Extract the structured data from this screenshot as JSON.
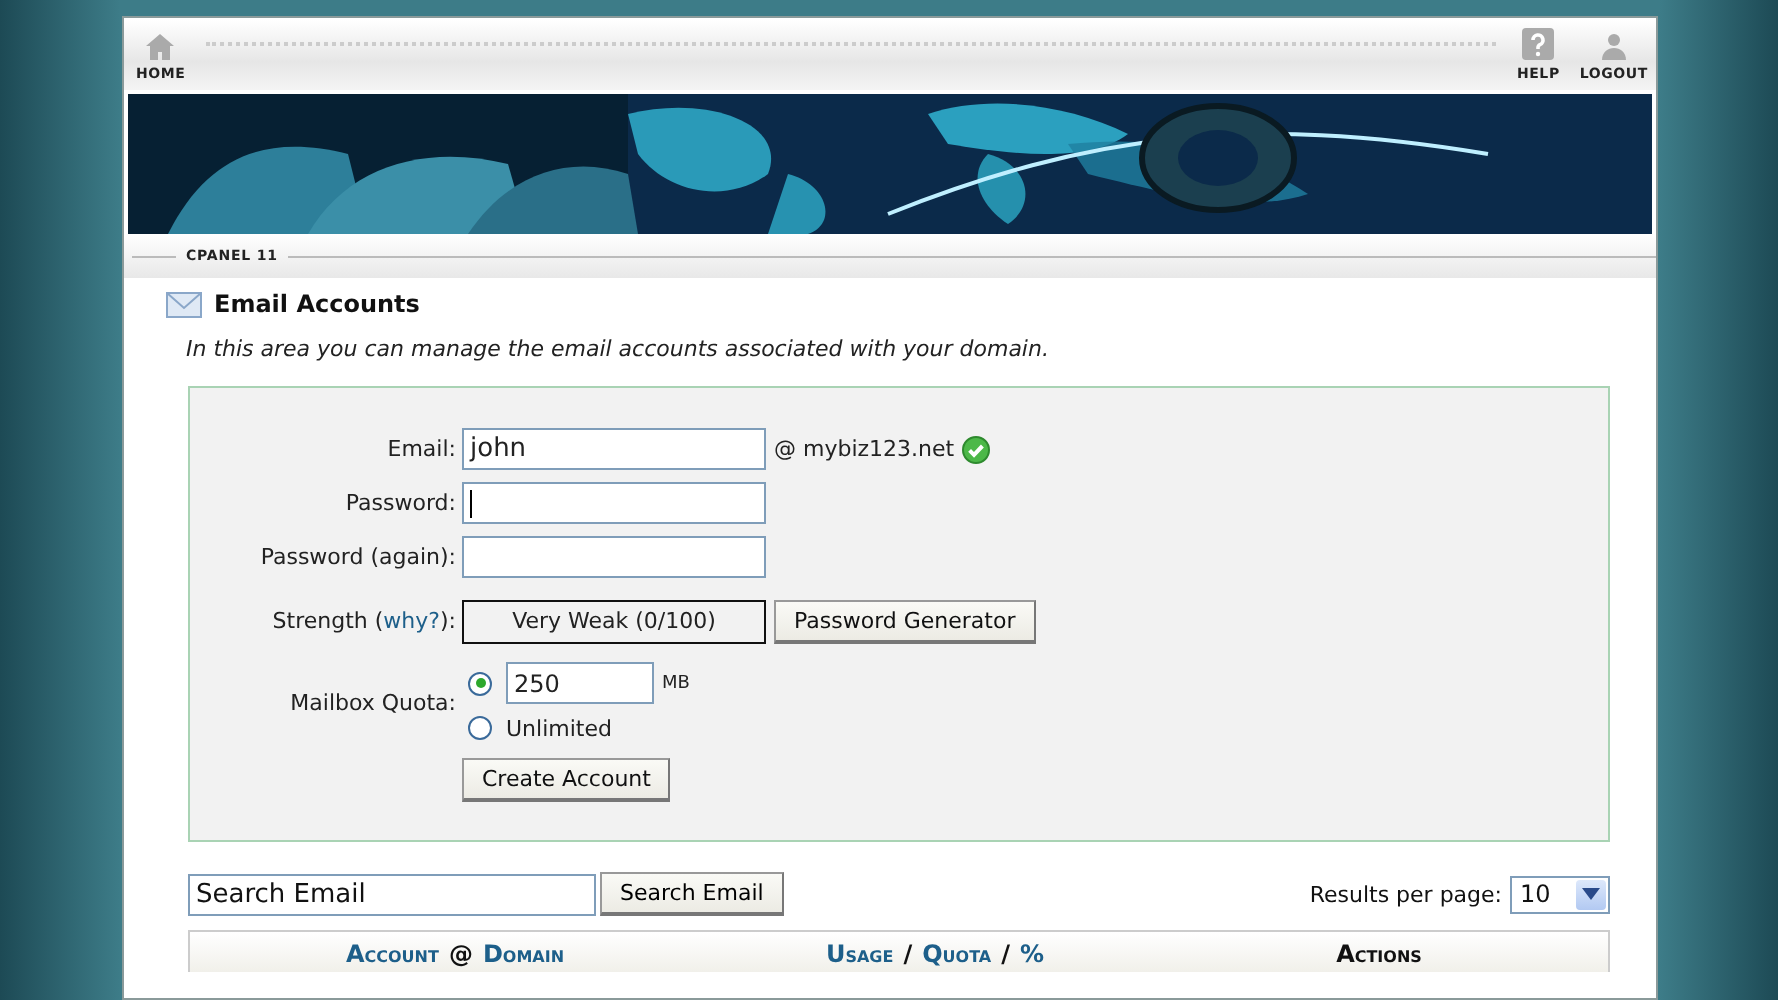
{
  "nav": {
    "home": "HOME",
    "help": "HELP",
    "logout": "LOGOUT"
  },
  "breadcrumb": "CPANEL 11",
  "section": {
    "title": "Email Accounts",
    "description": "In this area you can manage the email accounts associated with your domain."
  },
  "form": {
    "email_label": "Email:",
    "email_value": "john",
    "domain": "@ mybiz123.net",
    "email_valid": true,
    "password_label": "Password:",
    "password_again_label": "Password (again):",
    "strength_before": "Strength (",
    "strength_link": "why?",
    "strength_after": "):",
    "strength_value": "Very Weak (0/100)",
    "generator_button": "Password Generator",
    "quota_label": "Mailbox Quota:",
    "quota_options": [
      {
        "kind": "amount",
        "selected": true,
        "value": "250",
        "unit": "MB"
      },
      {
        "kind": "unlimited",
        "selected": false,
        "label": "Unlimited"
      }
    ],
    "create_button": "Create Account"
  },
  "search": {
    "value": "Search Email",
    "button": "Search Email",
    "per_page_label": "Results per page:",
    "per_page_value": "10"
  },
  "table": {
    "columns": [
      {
        "parts": [
          {
            "text": "Account",
            "link": true
          },
          {
            "text": "@",
            "link": false
          },
          {
            "text": "Domain",
            "link": true
          }
        ]
      },
      {
        "parts": [
          {
            "text": "Usage",
            "link": true
          },
          {
            "text": "/",
            "link": false
          },
          {
            "text": "Quota",
            "link": true
          },
          {
            "text": "/",
            "link": false
          },
          {
            "text": "%",
            "link": true
          }
        ]
      },
      {
        "parts": [
          {
            "text": "Actions",
            "link": false
          }
        ]
      }
    ]
  }
}
